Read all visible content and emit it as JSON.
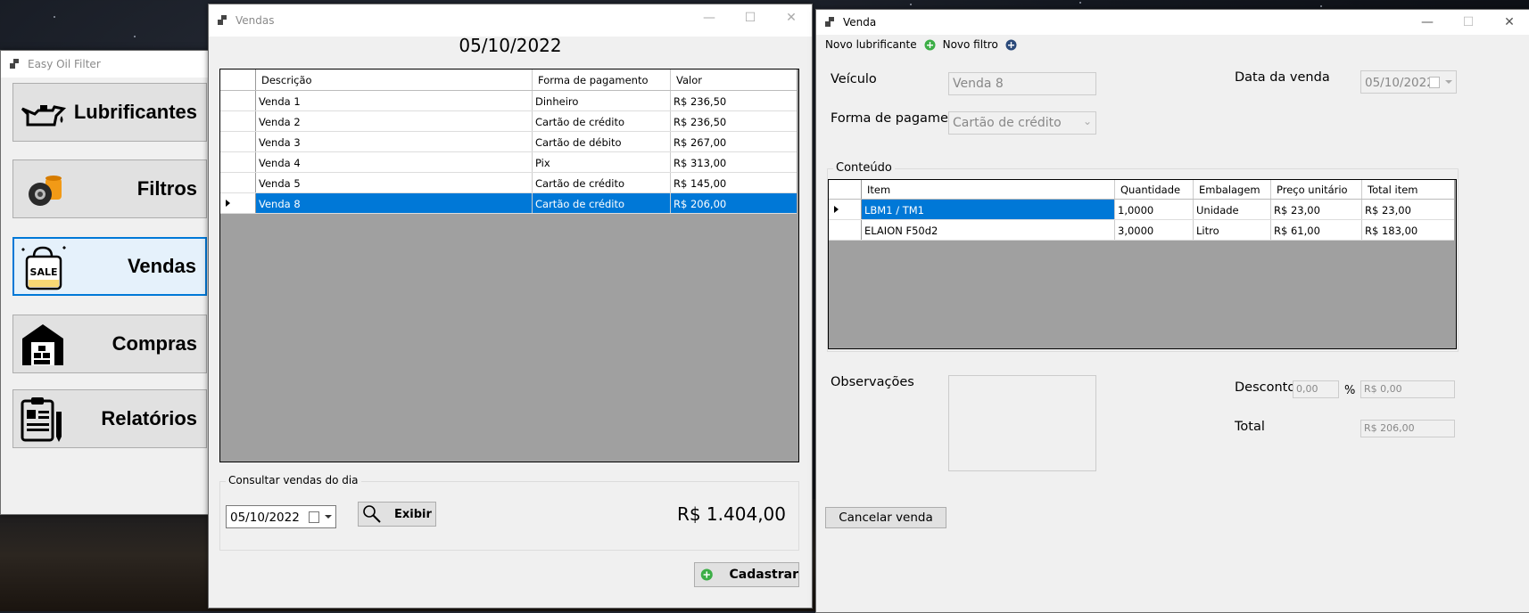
{
  "main_window": {
    "title": "Easy Oil Filter",
    "menu": [
      {
        "label": "Lubrificantes",
        "icon": "oil-can-icon"
      },
      {
        "label": "Filtros",
        "icon": "oil-filter-icon"
      },
      {
        "label": "Vendas",
        "icon": "sale-bag-icon"
      },
      {
        "label": "Compras",
        "icon": "warehouse-icon"
      },
      {
        "label": "Relatórios",
        "icon": "clipboard-report-icon"
      }
    ]
  },
  "vendas_window": {
    "title": "Vendas",
    "date_heading": "05/10/2022",
    "grid": {
      "columns": [
        "Descrição",
        "Forma de pagamento",
        "Valor"
      ],
      "rows": [
        [
          "Venda 1",
          "Dinheiro",
          "R$ 236,50"
        ],
        [
          "Venda 2",
          "Cartão de crédito",
          "R$ 236,50"
        ],
        [
          "Venda 3",
          "Cartão de débito",
          "R$ 267,00"
        ],
        [
          "Venda 4",
          "Pix",
          "R$ 313,00"
        ],
        [
          "Venda 5",
          "Cartão de crédito",
          "R$ 145,00"
        ],
        [
          "Venda 8",
          "Cartão de crédito",
          "R$ 206,00"
        ]
      ],
      "selected_row": 5
    },
    "consulta": {
      "legend": "Consultar vendas do dia",
      "date": "05/10/2022",
      "button": "Exibir",
      "total": "R$ 1.404,00"
    },
    "cadastrar_button": "Cadastrar"
  },
  "venda_window": {
    "title": "Venda",
    "toolbar": {
      "novo_lubrificante": "Novo lubrificante",
      "novo_filtro": "Novo filtro"
    },
    "veiculo_label": "Veículo",
    "veiculo_value": "Venda 8",
    "forma_label": "Forma de pagamento",
    "forma_value": "Cartão de crédito",
    "data_label": "Data da venda",
    "data_value": "05/10/2022",
    "conteudo_legend": "Conteúdo",
    "items_grid": {
      "columns": [
        "Item",
        "Quantidade",
        "Embalagem",
        "Preço unitário",
        "Total item"
      ],
      "rows": [
        [
          "LBM1 / TM1",
          "1,0000",
          "Unidade",
          "R$ 23,00",
          "R$ 23,00"
        ],
        [
          "ELAION F50d2",
          "3,0000",
          "Litro",
          "R$ 61,00",
          "R$ 183,00"
        ]
      ]
    },
    "observacoes_label": "Observações",
    "desconto_label": "Desconto",
    "desconto_percent": "0,00",
    "percent_sign": "%",
    "desconto_value": "R$ 0,00",
    "total_label": "Total",
    "total_value": "R$ 206,00",
    "cancelar_button": "Cancelar venda"
  },
  "colors": {
    "selection": "#0078d7",
    "window_bg": "#f0f0f0",
    "grid_bg": "#a0a0a0"
  }
}
